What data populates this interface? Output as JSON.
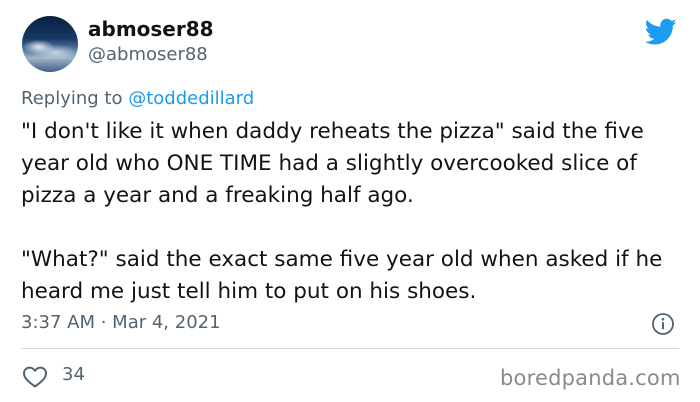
{
  "author": {
    "display_name": "abmoser88",
    "handle": "@abmoser88",
    "avatar": "night-sky-clouds-avatar"
  },
  "reply": {
    "prefix": "Replying to ",
    "mention": "@toddedillard"
  },
  "tweet": {
    "paragraph_1": "\"I don't like it when daddy reheats the pizza\" said the five year old who ONE TIME had a slightly overcooked slice of pizza a year and a freaking half ago.",
    "paragraph_2": "\"What?\" said the exact same five year old when asked if he heard me just tell him to put on his shoes."
  },
  "meta": {
    "time": "3:37 AM",
    "separator": " · ",
    "date": "Mar 4, 2021"
  },
  "engagement": {
    "likes": "34"
  },
  "watermark": "boredpanda.com",
  "colors": {
    "twitter_blue": "#1d9bf0",
    "secondary_text": "#536471",
    "divider": "#cfd9de"
  },
  "icons": {
    "brand": "twitter-bird-icon",
    "info": "info-icon",
    "like": "heart-icon"
  }
}
